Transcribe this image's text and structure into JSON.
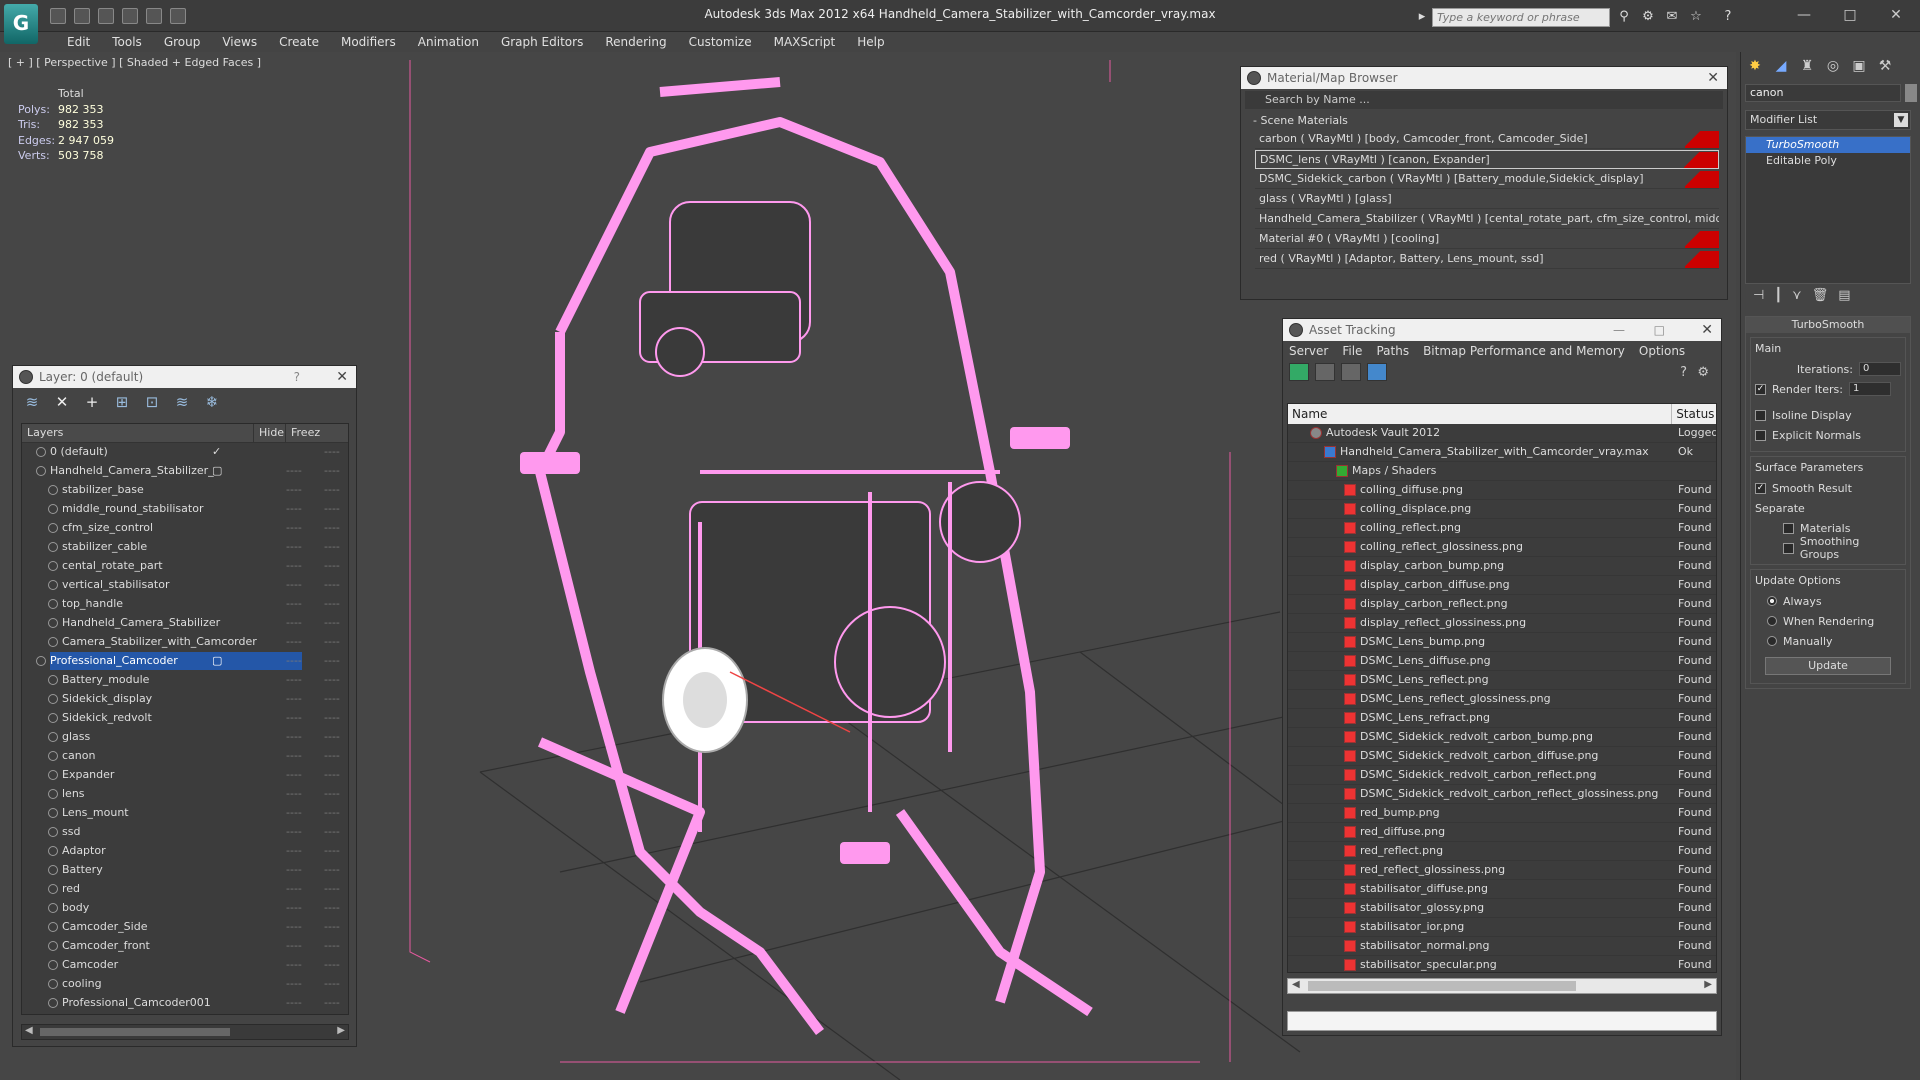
{
  "window": {
    "title": "Autodesk 3ds Max  2012 x64      Handheld_Camera_Stabilizer_with_Camcorder_vray.max",
    "search_placeholder": "Type a keyword or phrase"
  },
  "menu": [
    "Edit",
    "Tools",
    "Group",
    "Views",
    "Create",
    "Modifiers",
    "Animation",
    "Graph Editors",
    "Rendering",
    "Customize",
    "MAXScript",
    "Help"
  ],
  "viewport": {
    "label": "[ + ] [ Perspective ] [ Shaded + Edged Faces ]",
    "stats": {
      "header": "Total",
      "rows": [
        {
          "label": "Polys:",
          "value": "982 353"
        },
        {
          "label": "Tris:",
          "value": "982 353"
        },
        {
          "label": "Edges:",
          "value": "2 947 059"
        },
        {
          "label": "Verts:",
          "value": "503 758"
        }
      ]
    },
    "wire_color": "#ff99ee"
  },
  "layer_panel": {
    "title": "Layer: 0 (default)",
    "help": "?",
    "col_layers": "Layers",
    "col_hide": "Hide",
    "col_freeze": "Freez",
    "rows": [
      {
        "name": "0 (default)",
        "level": 0,
        "mark": "✓",
        "hide": "",
        "freeze": "----"
      },
      {
        "name": "Handheld_Camera_Stabilizer_",
        "level": 0,
        "mark": "▢",
        "hide": "----",
        "freeze": "----"
      },
      {
        "name": "stabilizer_base",
        "level": 1,
        "mark": "",
        "hide": "----",
        "freeze": "----"
      },
      {
        "name": "middle_round_stabilisator",
        "level": 1,
        "mark": "",
        "hide": "----",
        "freeze": "----"
      },
      {
        "name": "cfm_size_control",
        "level": 1,
        "mark": "",
        "hide": "----",
        "freeze": "----"
      },
      {
        "name": "stabilizer_cable",
        "level": 1,
        "mark": "",
        "hide": "----",
        "freeze": "----"
      },
      {
        "name": "cental_rotate_part",
        "level": 1,
        "mark": "",
        "hide": "----",
        "freeze": "----"
      },
      {
        "name": "vertical_stabilisator",
        "level": 1,
        "mark": "",
        "hide": "----",
        "freeze": "----"
      },
      {
        "name": "top_handle",
        "level": 1,
        "mark": "",
        "hide": "----",
        "freeze": "----"
      },
      {
        "name": "Handheld_Camera_Stabilizer",
        "level": 1,
        "mark": "",
        "hide": "----",
        "freeze": "----"
      },
      {
        "name": "Camera_Stabilizer_with_Camcorder",
        "level": 1,
        "mark": "",
        "hide": "----",
        "freeze": "----"
      },
      {
        "name": "Professional_Camcoder",
        "level": 0,
        "mark": "▢",
        "hide": "----",
        "freeze": "----",
        "selected": true
      },
      {
        "name": "Battery_module",
        "level": 1,
        "mark": "",
        "hide": "----",
        "freeze": "----"
      },
      {
        "name": "Sidekick_display",
        "level": 1,
        "mark": "",
        "hide": "----",
        "freeze": "----"
      },
      {
        "name": "Sidekick_redvolt",
        "level": 1,
        "mark": "",
        "hide": "----",
        "freeze": "----"
      },
      {
        "name": "glass",
        "level": 1,
        "mark": "",
        "hide": "----",
        "freeze": "----"
      },
      {
        "name": "canon",
        "level": 1,
        "mark": "",
        "hide": "----",
        "freeze": "----"
      },
      {
        "name": "Expander",
        "level": 1,
        "mark": "",
        "hide": "----",
        "freeze": "----"
      },
      {
        "name": "lens",
        "level": 1,
        "mark": "",
        "hide": "----",
        "freeze": "----"
      },
      {
        "name": "Lens_mount",
        "level": 1,
        "mark": "",
        "hide": "----",
        "freeze": "----"
      },
      {
        "name": "ssd",
        "level": 1,
        "mark": "",
        "hide": "----",
        "freeze": "----"
      },
      {
        "name": "Adaptor",
        "level": 1,
        "mark": "",
        "hide": "----",
        "freeze": "----"
      },
      {
        "name": "Battery",
        "level": 1,
        "mark": "",
        "hide": "----",
        "freeze": "----"
      },
      {
        "name": "red",
        "level": 1,
        "mark": "",
        "hide": "----",
        "freeze": "----"
      },
      {
        "name": "body",
        "level": 1,
        "mark": "",
        "hide": "----",
        "freeze": "----"
      },
      {
        "name": "Camcoder_Side",
        "level": 1,
        "mark": "",
        "hide": "----",
        "freeze": "----"
      },
      {
        "name": "Camcoder_front",
        "level": 1,
        "mark": "",
        "hide": "----",
        "freeze": "----"
      },
      {
        "name": "Camcoder",
        "level": 1,
        "mark": "",
        "hide": "----",
        "freeze": "----"
      },
      {
        "name": "cooling",
        "level": 1,
        "mark": "",
        "hide": "----",
        "freeze": "----"
      },
      {
        "name": "Professional_Camcoder001",
        "level": 1,
        "mark": "",
        "hide": "----",
        "freeze": "----"
      }
    ]
  },
  "material_browser": {
    "title": "Material/Map Browser",
    "search_placeholder": "Search by Name ...",
    "section": "- Scene Materials",
    "rows": [
      {
        "text": "carbon  ( VRayMtl )  [body, Camcoder_front, Camcoder_Side]"
      },
      {
        "text": "DSMC_lens  ( VRayMtl )  [canon, Expander]",
        "selected": true
      },
      {
        "text": "DSMC_Sidekick_carbon  ( VRayMtl )  [Battery_module,Sidekick_display]"
      },
      {
        "text": "glass  ( VRayMtl )  [glass]"
      },
      {
        "text": "Handheld_Camera_Stabilizer  ( VRayMtl )  [cental_rotate_part, cfm_size_control, middle..."
      },
      {
        "text": "Material #0  ( VRayMtl )  [cooling]"
      },
      {
        "text": "red  ( VRayMtl )  [Adaptor, Battery, Lens_mount, ssd]"
      }
    ]
  },
  "asset_tracking": {
    "title": "Asset Tracking",
    "menu": [
      "Server",
      "File",
      "Paths",
      "Bitmap Performance and Memory",
      "Options"
    ],
    "col_name": "Name",
    "col_status": "Status",
    "rows": [
      {
        "name": "Autodesk Vault 2012",
        "level": 0,
        "status": "Logged"
      },
      {
        "name": "Handheld_Camera_Stabilizer_with_Camcorder_vray.max",
        "level": 1,
        "status": "Ok"
      },
      {
        "name": "Maps / Shaders",
        "level": 2,
        "status": ""
      },
      {
        "name": "colling_diffuse.png",
        "level": 3,
        "status": "Found"
      },
      {
        "name": "colling_displace.png",
        "level": 3,
        "status": "Found"
      },
      {
        "name": "colling_reflect.png",
        "level": 3,
        "status": "Found"
      },
      {
        "name": "colling_reflect_glossiness.png",
        "level": 3,
        "status": "Found"
      },
      {
        "name": "display_carbon_bump.png",
        "level": 3,
        "status": "Found"
      },
      {
        "name": "display_carbon_diffuse.png",
        "level": 3,
        "status": "Found"
      },
      {
        "name": "display_carbon_reflect.png",
        "level": 3,
        "status": "Found"
      },
      {
        "name": "display_reflect_glossiness.png",
        "level": 3,
        "status": "Found"
      },
      {
        "name": "DSMC_Lens_bump.png",
        "level": 3,
        "status": "Found"
      },
      {
        "name": "DSMC_Lens_diffuse.png",
        "level": 3,
        "status": "Found"
      },
      {
        "name": "DSMC_Lens_reflect.png",
        "level": 3,
        "status": "Found"
      },
      {
        "name": "DSMC_Lens_reflect_glossiness.png",
        "level": 3,
        "status": "Found"
      },
      {
        "name": "DSMC_Lens_refract.png",
        "level": 3,
        "status": "Found"
      },
      {
        "name": "DSMC_Sidekick_redvolt_carbon_bump.png",
        "level": 3,
        "status": "Found"
      },
      {
        "name": "DSMC_Sidekick_redvolt_carbon_diffuse.png",
        "level": 3,
        "status": "Found"
      },
      {
        "name": "DSMC_Sidekick_redvolt_carbon_reflect.png",
        "level": 3,
        "status": "Found"
      },
      {
        "name": "DSMC_Sidekick_redvolt_carbon_reflect_glossiness.png",
        "level": 3,
        "status": "Found"
      },
      {
        "name": "red_bump.png",
        "level": 3,
        "status": "Found"
      },
      {
        "name": "red_diffuse.png",
        "level": 3,
        "status": "Found"
      },
      {
        "name": "red_reflect.png",
        "level": 3,
        "status": "Found"
      },
      {
        "name": "red_reflect_glossiness.png",
        "level": 3,
        "status": "Found"
      },
      {
        "name": "stabilisator_diffuse.png",
        "level": 3,
        "status": "Found"
      },
      {
        "name": "stabilisator_glossy.png",
        "level": 3,
        "status": "Found"
      },
      {
        "name": "stabilisator_ior.png",
        "level": 3,
        "status": "Found"
      },
      {
        "name": "stabilisator_normal.png",
        "level": 3,
        "status": "Found"
      },
      {
        "name": "stabilisator_specular.png",
        "level": 3,
        "status": "Found"
      }
    ]
  },
  "command_panel": {
    "object_name": "canon",
    "modifier_list": "Modifier List",
    "stack": [
      "TurboSmooth",
      "Editable Poly"
    ],
    "rollout_title": "TurboSmooth",
    "main_group": "Main",
    "iterations_label": "Iterations:",
    "iterations_value": "0",
    "render_iters_label": "Render Iters:",
    "render_iters_value": "1",
    "isoline": "Isoline Display",
    "explicit_normals": "Explicit Normals",
    "surface_group": "Surface Parameters",
    "smooth_result": "Smooth Result",
    "separate": "Separate",
    "materials": "Materials",
    "smoothing_groups": "Smoothing Groups",
    "update_group": "Update Options",
    "always": "Always",
    "when_rendering": "When Rendering",
    "manually": "Manually",
    "update_button": "Update"
  }
}
